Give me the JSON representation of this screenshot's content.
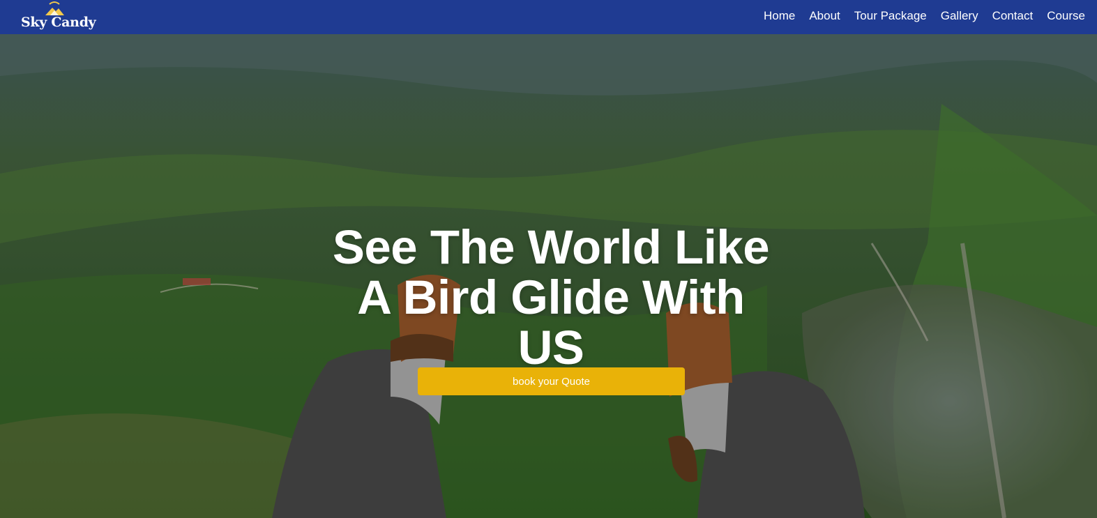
{
  "brand": {
    "name": "Sky Candy",
    "logo_icon": "paraglider-mountain-icon",
    "color": "#1f3b92"
  },
  "nav": {
    "items": [
      {
        "label": "Home"
      },
      {
        "label": "About"
      },
      {
        "label": "Tour Package"
      },
      {
        "label": "Gallery"
      },
      {
        "label": "Contact"
      },
      {
        "label": "Course"
      }
    ]
  },
  "hero": {
    "headline_lines": [
      "See The World Like",
      "A Bird Glide With",
      "US"
    ],
    "cta_label": "book your Quote",
    "cta_color": "#e9b208",
    "background_icon": "paragliding-feet-over-valley-photo"
  }
}
